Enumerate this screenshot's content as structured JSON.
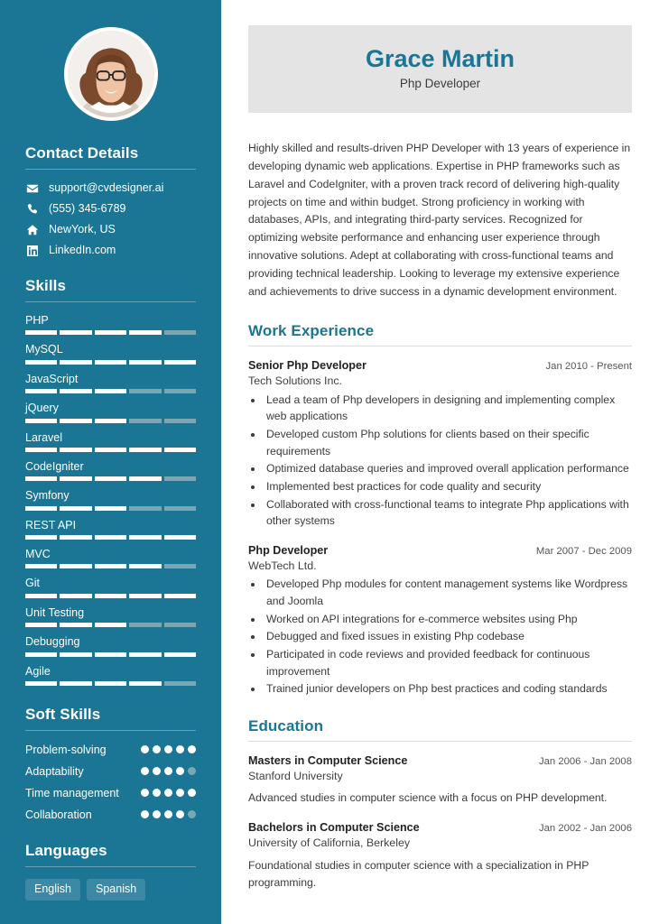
{
  "sidebar": {
    "avatar_alt": "profile-photo",
    "contact": {
      "heading": "Contact Details",
      "items": [
        {
          "icon": "envelope-icon",
          "text": "support@cvdesigner.ai"
        },
        {
          "icon": "phone-icon",
          "text": "(555) 345-6789"
        },
        {
          "icon": "home-icon",
          "text": "NewYork, US"
        },
        {
          "icon": "linkedin-icon",
          "text": "LinkedIn.com"
        }
      ]
    },
    "skills": {
      "heading": "Skills",
      "max": 5,
      "items": [
        {
          "name": "PHP",
          "level": 4
        },
        {
          "name": "MySQL",
          "level": 5
        },
        {
          "name": "JavaScript",
          "level": 3
        },
        {
          "name": "jQuery",
          "level": 3
        },
        {
          "name": "Laravel",
          "level": 5
        },
        {
          "name": "CodeIgniter",
          "level": 4
        },
        {
          "name": "Symfony",
          "level": 3
        },
        {
          "name": "REST API",
          "level": 5
        },
        {
          "name": "MVC",
          "level": 4
        },
        {
          "name": "Git",
          "level": 5
        },
        {
          "name": "Unit Testing",
          "level": 3
        },
        {
          "name": "Debugging",
          "level": 5
        },
        {
          "name": "Agile",
          "level": 4
        }
      ]
    },
    "soft_skills": {
      "heading": "Soft Skills",
      "max": 5,
      "items": [
        {
          "name": "Problem-solving",
          "level": 5
        },
        {
          "name": "Adaptability",
          "level": 4
        },
        {
          "name": "Time management",
          "level": 5
        },
        {
          "name": "Collaboration",
          "level": 4
        }
      ]
    },
    "languages": {
      "heading": "Languages",
      "items": [
        "English",
        "Spanish"
      ]
    }
  },
  "main": {
    "header": {
      "name": "Grace Martin",
      "title": "Php Developer"
    },
    "summary": "Highly skilled and results-driven PHP Developer with 13 years of experience in developing dynamic web applications. Expertise in PHP frameworks such as Laravel and CodeIgniter, with a proven track record of delivering high-quality projects on time and within budget. Strong proficiency in working with databases, APIs, and integrating third-party services. Recognized for optimizing website performance and enhancing user experience through innovative solutions. Adept at collaborating with cross-functional teams and providing technical leadership. Looking to leverage my extensive experience and achievements to drive success in a dynamic development environment.",
    "work": {
      "heading": "Work Experience",
      "entries": [
        {
          "role": "Senior Php Developer",
          "date": "Jan 2010 - Present",
          "org": "Tech Solutions Inc.",
          "bullets": [
            "Lead a team of Php developers in designing and implementing complex web applications",
            "Developed custom Php solutions for clients based on their specific requirements",
            "Optimized database queries and improved overall application performance",
            "Implemented best practices for code quality and security",
            "Collaborated with cross-functional teams to integrate Php applications with other systems"
          ]
        },
        {
          "role": "Php Developer",
          "date": "Mar 2007 - Dec 2009",
          "org": "WebTech Ltd.",
          "bullets": [
            "Developed Php modules for content management systems like Wordpress and Joomla",
            "Worked on API integrations for e-commerce websites using Php",
            "Debugged and fixed issues in existing Php codebase",
            "Participated in code reviews and provided feedback for continuous improvement",
            "Trained junior developers on Php best practices and coding standards"
          ]
        }
      ]
    },
    "education": {
      "heading": "Education",
      "entries": [
        {
          "degree": "Masters in Computer Science",
          "date": "Jan 2006 - Jan 2008",
          "school": "Stanford University",
          "description": "Advanced studies in computer science with a focus on PHP development."
        },
        {
          "degree": "Bachelors in Computer Science",
          "date": "Jan 2002 - Jan 2006",
          "school": "University of California, Berkeley",
          "description": "Foundational studies in computer science with a specialization in PHP programming."
        }
      ]
    }
  },
  "colors": {
    "sidebar": "#1b7594",
    "accent": "#1b7594",
    "name_band": "#e4e4e4",
    "muted_bar": "#7ba7b5",
    "chip": "#3b89a4"
  }
}
